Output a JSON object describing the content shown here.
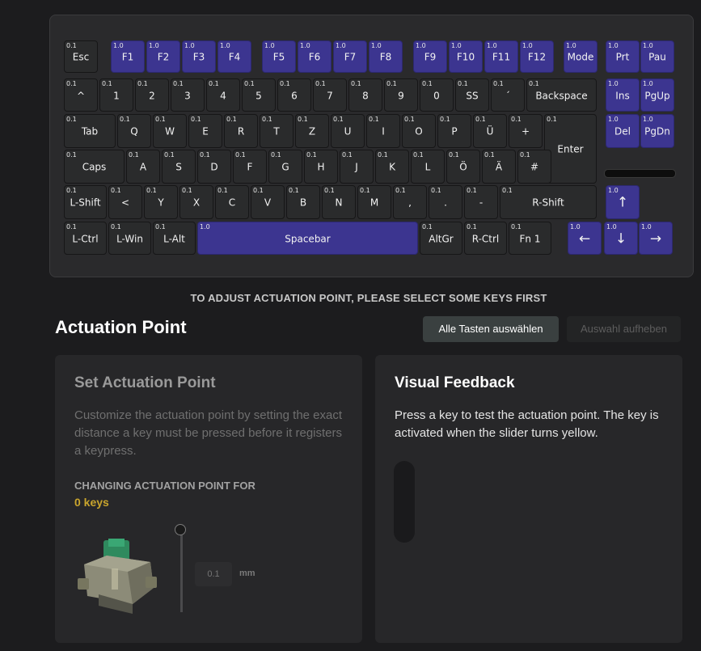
{
  "keyboard": {
    "rows": [
      [
        {
          "label": "Esc",
          "act": "0.1"
        },
        {
          "label": "F1",
          "act": "1.0",
          "hl": true
        },
        {
          "label": "F2",
          "act": "1.0",
          "hl": true
        },
        {
          "label": "F3",
          "act": "1.0",
          "hl": true
        },
        {
          "label": "F4",
          "act": "1.0",
          "hl": true
        },
        {
          "label": "F5",
          "act": "1.0",
          "hl": true
        },
        {
          "label": "F6",
          "act": "1.0",
          "hl": true
        },
        {
          "label": "F7",
          "act": "1.0",
          "hl": true
        },
        {
          "label": "F8",
          "act": "1.0",
          "hl": true
        },
        {
          "label": "F9",
          "act": "1.0",
          "hl": true
        },
        {
          "label": "F10",
          "act": "1.0",
          "hl": true
        },
        {
          "label": "F11",
          "act": "1.0",
          "hl": true
        },
        {
          "label": "F12",
          "act": "1.0",
          "hl": true
        },
        {
          "label": "Mode",
          "act": "1.0",
          "hl": true
        },
        {
          "label": "Prt",
          "act": "1.0",
          "hl": true
        },
        {
          "label": "Pau",
          "act": "1.0",
          "hl": true
        }
      ],
      [
        {
          "label": "^",
          "act": "0.1"
        },
        {
          "label": "1",
          "act": "0.1"
        },
        {
          "label": "2",
          "act": "0.1"
        },
        {
          "label": "3",
          "act": "0.1"
        },
        {
          "label": "4",
          "act": "0.1"
        },
        {
          "label": "5",
          "act": "0.1"
        },
        {
          "label": "6",
          "act": "0.1"
        },
        {
          "label": "7",
          "act": "0.1"
        },
        {
          "label": "8",
          "act": "0.1"
        },
        {
          "label": "9",
          "act": "0.1"
        },
        {
          "label": "0",
          "act": "0.1"
        },
        {
          "label": "SS",
          "act": "0.1"
        },
        {
          "label": "´",
          "act": "0.1"
        },
        {
          "label": "Backspace",
          "act": "0.1"
        },
        {
          "label": "Ins",
          "act": "1.0",
          "hl": true
        },
        {
          "label": "PgUp",
          "act": "1.0",
          "hl": true
        }
      ],
      [
        {
          "label": "Tab",
          "act": "0.1"
        },
        {
          "label": "Q",
          "act": "0.1"
        },
        {
          "label": "W",
          "act": "0.1"
        },
        {
          "label": "E",
          "act": "0.1"
        },
        {
          "label": "R",
          "act": "0.1"
        },
        {
          "label": "T",
          "act": "0.1"
        },
        {
          "label": "Z",
          "act": "0.1"
        },
        {
          "label": "U",
          "act": "0.1"
        },
        {
          "label": "I",
          "act": "0.1"
        },
        {
          "label": "O",
          "act": "0.1"
        },
        {
          "label": "P",
          "act": "0.1"
        },
        {
          "label": "Ü",
          "act": "0.1"
        },
        {
          "label": "+",
          "act": "0.1"
        },
        {
          "label": "Enter",
          "act": "0.1"
        },
        {
          "label": "Del",
          "act": "1.0",
          "hl": true
        },
        {
          "label": "PgDn",
          "act": "1.0",
          "hl": true
        }
      ],
      [
        {
          "label": "Caps",
          "act": "0.1"
        },
        {
          "label": "A",
          "act": "0.1"
        },
        {
          "label": "S",
          "act": "0.1"
        },
        {
          "label": "D",
          "act": "0.1"
        },
        {
          "label": "F",
          "act": "0.1"
        },
        {
          "label": "G",
          "act": "0.1"
        },
        {
          "label": "H",
          "act": "0.1"
        },
        {
          "label": "J",
          "act": "0.1"
        },
        {
          "label": "K",
          "act": "0.1"
        },
        {
          "label": "L",
          "act": "0.1"
        },
        {
          "label": "Ö",
          "act": "0.1"
        },
        {
          "label": "Ä",
          "act": "0.1"
        },
        {
          "label": "#",
          "act": "0.1"
        }
      ],
      [
        {
          "label": "L-Shift",
          "act": "0.1"
        },
        {
          "label": "<",
          "act": "0.1"
        },
        {
          "label": "Y",
          "act": "0.1"
        },
        {
          "label": "X",
          "act": "0.1"
        },
        {
          "label": "C",
          "act": "0.1"
        },
        {
          "label": "V",
          "act": "0.1"
        },
        {
          "label": "B",
          "act": "0.1"
        },
        {
          "label": "N",
          "act": "0.1"
        },
        {
          "label": "M",
          "act": "0.1"
        },
        {
          "label": ",",
          "act": "0.1"
        },
        {
          "label": ".",
          "act": "0.1"
        },
        {
          "label": "-",
          "act": "0.1"
        },
        {
          "label": "R-Shift",
          "act": "0.1"
        },
        {
          "label": "↑",
          "act": "1.0",
          "hl": true
        }
      ],
      [
        {
          "label": "L-Ctrl",
          "act": "0.1"
        },
        {
          "label": "L-Win",
          "act": "0.1"
        },
        {
          "label": "L-Alt",
          "act": "0.1"
        },
        {
          "label": "Spacebar",
          "act": "1.0",
          "hl": true
        },
        {
          "label": "AltGr",
          "act": "0.1"
        },
        {
          "label": "R-Ctrl",
          "act": "0.1"
        },
        {
          "label": "Fn 1",
          "act": "0.1"
        },
        {
          "label": "←",
          "act": "1.0",
          "hl": true
        },
        {
          "label": "↓",
          "act": "1.0",
          "hl": true
        },
        {
          "label": "→",
          "act": "1.0",
          "hl": true
        }
      ]
    ]
  },
  "hint": "TO ADJUST ACTUATION POINT, PLEASE SELECT SOME KEYS FIRST",
  "section_title": "Actuation Point",
  "buttons": {
    "select_all": "Alle Tasten auswählen",
    "clear_selection": "Auswahl aufheben"
  },
  "set_panel": {
    "title": "Set Actuation Point",
    "description": "Customize the actuation point by setting the exact distance a key must be pressed before it registers a keypress.",
    "changing_label": "CHANGING ACTUATION POINT FOR",
    "key_count": "0 keys",
    "input_placeholder": "0.1",
    "unit": "mm"
  },
  "visual_panel": {
    "title": "Visual Feedback",
    "description": "Press a key to test the actuation point. The key is activated when the slider turns yellow."
  },
  "colors": {
    "selected_key": "#3c3590",
    "count_accent": "#c9a52d",
    "background": "#1c1c1e"
  }
}
